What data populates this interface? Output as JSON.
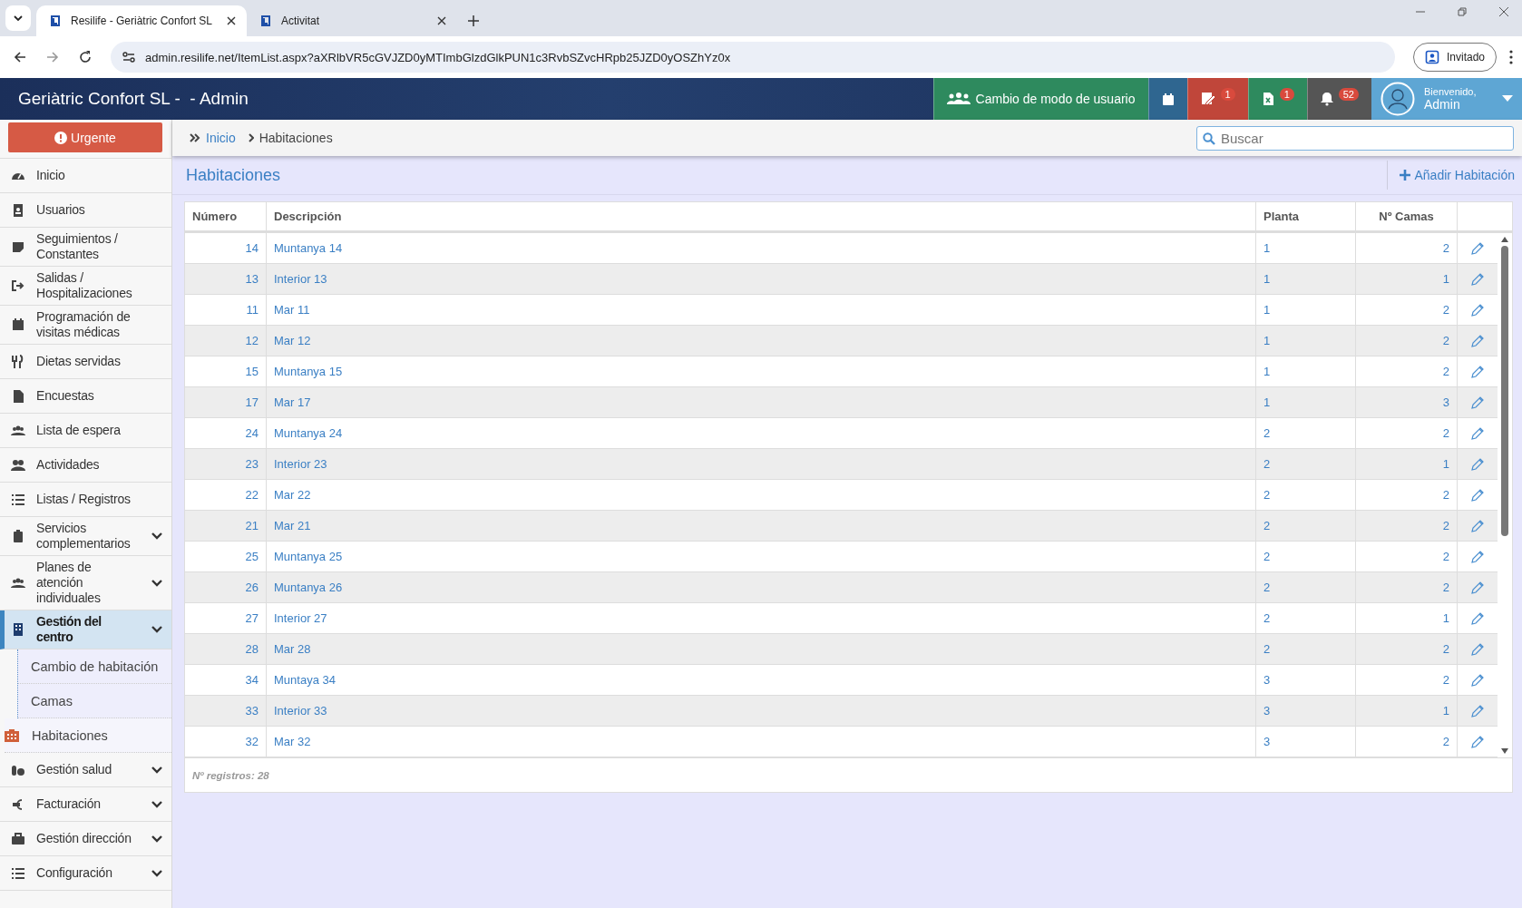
{
  "browser": {
    "tabs": [
      {
        "title": "Resilife - Geriàtric Confort SL",
        "selected": true
      },
      {
        "title": "Activitat",
        "selected": false
      }
    ],
    "url": "admin.resilife.net/ItemList.aspx?aXRlbVR5cGVJZD0yMTImbGlzdGlkPUN1c3RvbSZvcHRpb25JZD0yOSZhYz0x",
    "profile": "Invitado"
  },
  "header": {
    "title": "Geriàtric Confort SL -  - Admin",
    "buttons": [
      {
        "label": "Cambio de modo de usuario",
        "color": "#2e8a5e"
      },
      {
        "color": "#2f6690"
      },
      {
        "badge": "1",
        "color": "#c0463a"
      },
      {
        "badge": "1",
        "color": "#2e8a5e"
      },
      {
        "badge": "52",
        "color": "#555555"
      }
    ],
    "user": {
      "greeting": "Bienvenido,",
      "name": "Admin"
    }
  },
  "sidebar": {
    "urgent": "Urgente",
    "items": [
      {
        "label": "Inicio",
        "kind": "link",
        "selected": false
      },
      {
        "label": "Usuarios",
        "kind": "link",
        "selected": false
      },
      {
        "label": "Seguimientos / Constantes",
        "kind": "link",
        "selected": false
      },
      {
        "label": "Salidas / Hospitalizaciones",
        "kind": "link",
        "selected": false
      },
      {
        "label": "Programación de visitas médicas",
        "kind": "link",
        "selected": false
      },
      {
        "label": "Dietas servidas",
        "kind": "link",
        "selected": false
      },
      {
        "label": "Encuestas",
        "kind": "link",
        "selected": false
      },
      {
        "label": "Lista de espera",
        "kind": "link",
        "selected": false
      },
      {
        "label": "Actividades",
        "kind": "link",
        "selected": false
      },
      {
        "label": "Listas / Registros",
        "kind": "link",
        "selected": false
      },
      {
        "label": "Servicios complementarios",
        "kind": "group",
        "selected": false
      },
      {
        "label": "Planes de atención individuales",
        "kind": "group",
        "selected": false
      },
      {
        "label": "Gestión del centro",
        "kind": "group",
        "selected": true,
        "expanded": true,
        "children": [
          {
            "label": "Cambio de habitación",
            "selected": false
          },
          {
            "label": "Camas",
            "selected": false
          },
          {
            "label": "Habitaciones",
            "selected": true
          }
        ]
      },
      {
        "label": "Gestión salud",
        "kind": "group",
        "selected": false
      },
      {
        "label": "Facturación",
        "kind": "group",
        "selected": false
      },
      {
        "label": "Gestión dirección",
        "kind": "group",
        "selected": false
      },
      {
        "label": "Configuración",
        "kind": "group",
        "selected": false
      }
    ]
  },
  "breadcrumb": [
    {
      "label": "Inicio",
      "kind": "link"
    },
    {
      "label": "Habitaciones",
      "kind": "current"
    }
  ],
  "search": {
    "placeholder": "Buscar"
  },
  "page_title": "Habitaciones",
  "add_button": "Añadir Habitación",
  "table": {
    "columns": [
      "Número",
      "Descripción",
      "Planta",
      "Nº Camas"
    ],
    "rows": [
      [
        "14",
        "Muntanya 14",
        "1",
        "2"
      ],
      [
        "13",
        "Interior 13",
        "1",
        "1"
      ],
      [
        "11",
        "Mar 11",
        "1",
        "2"
      ],
      [
        "12",
        "Mar 12",
        "1",
        "2"
      ],
      [
        "15",
        "Muntanya 15",
        "1",
        "2"
      ],
      [
        "17",
        "Mar 17",
        "1",
        "3"
      ],
      [
        "24",
        "Muntanya 24",
        "2",
        "2"
      ],
      [
        "23",
        "Interior 23",
        "2",
        "1"
      ],
      [
        "22",
        "Mar 22",
        "2",
        "2"
      ],
      [
        "21",
        "Mar 21",
        "2",
        "2"
      ],
      [
        "25",
        "Muntanya 25",
        "2",
        "2"
      ],
      [
        "26",
        "Muntanya 26",
        "2",
        "2"
      ],
      [
        "27",
        "Interior 27",
        "2",
        "1"
      ],
      [
        "28",
        "Mar 28",
        "2",
        "2"
      ],
      [
        "34",
        "Muntaya 34",
        "3",
        "2"
      ],
      [
        "33",
        "Interior 33",
        "3",
        "1"
      ],
      [
        "32",
        "Mar 32",
        "3",
        "2"
      ]
    ],
    "footer": "Nº registros: 28"
  }
}
